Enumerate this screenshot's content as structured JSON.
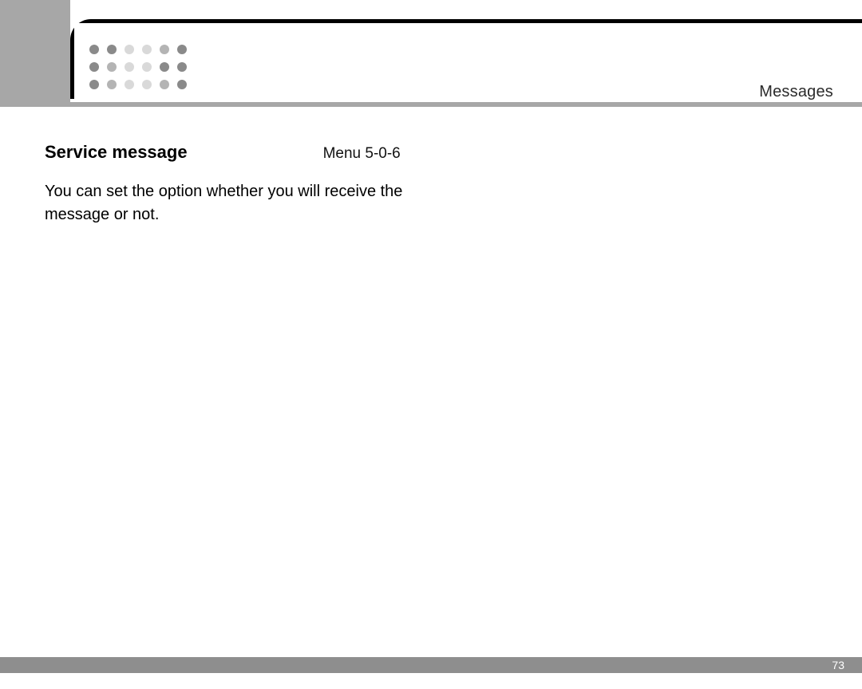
{
  "header": {
    "section": "Messages"
  },
  "dots": {
    "palette": [
      "#8a8a8a",
      "#8a8a8a",
      "#d9d9d9",
      "#d9d9d9",
      "#b4b4b4",
      "#8a8a8a",
      "#8a8a8a",
      "#b4b4b4",
      "#d9d9d9",
      "#d9d9d9",
      "#8a8a8a",
      "#8a8a8a",
      "#8a8a8a",
      "#b4b4b4",
      "#d9d9d9",
      "#d9d9d9",
      "#b4b4b4",
      "#8a8a8a"
    ]
  },
  "content": {
    "title": "Service message",
    "menu": "Menu 5-0-6",
    "body": "You can set the option whether you will receive the message or not."
  },
  "footer": {
    "page_number": "73"
  }
}
